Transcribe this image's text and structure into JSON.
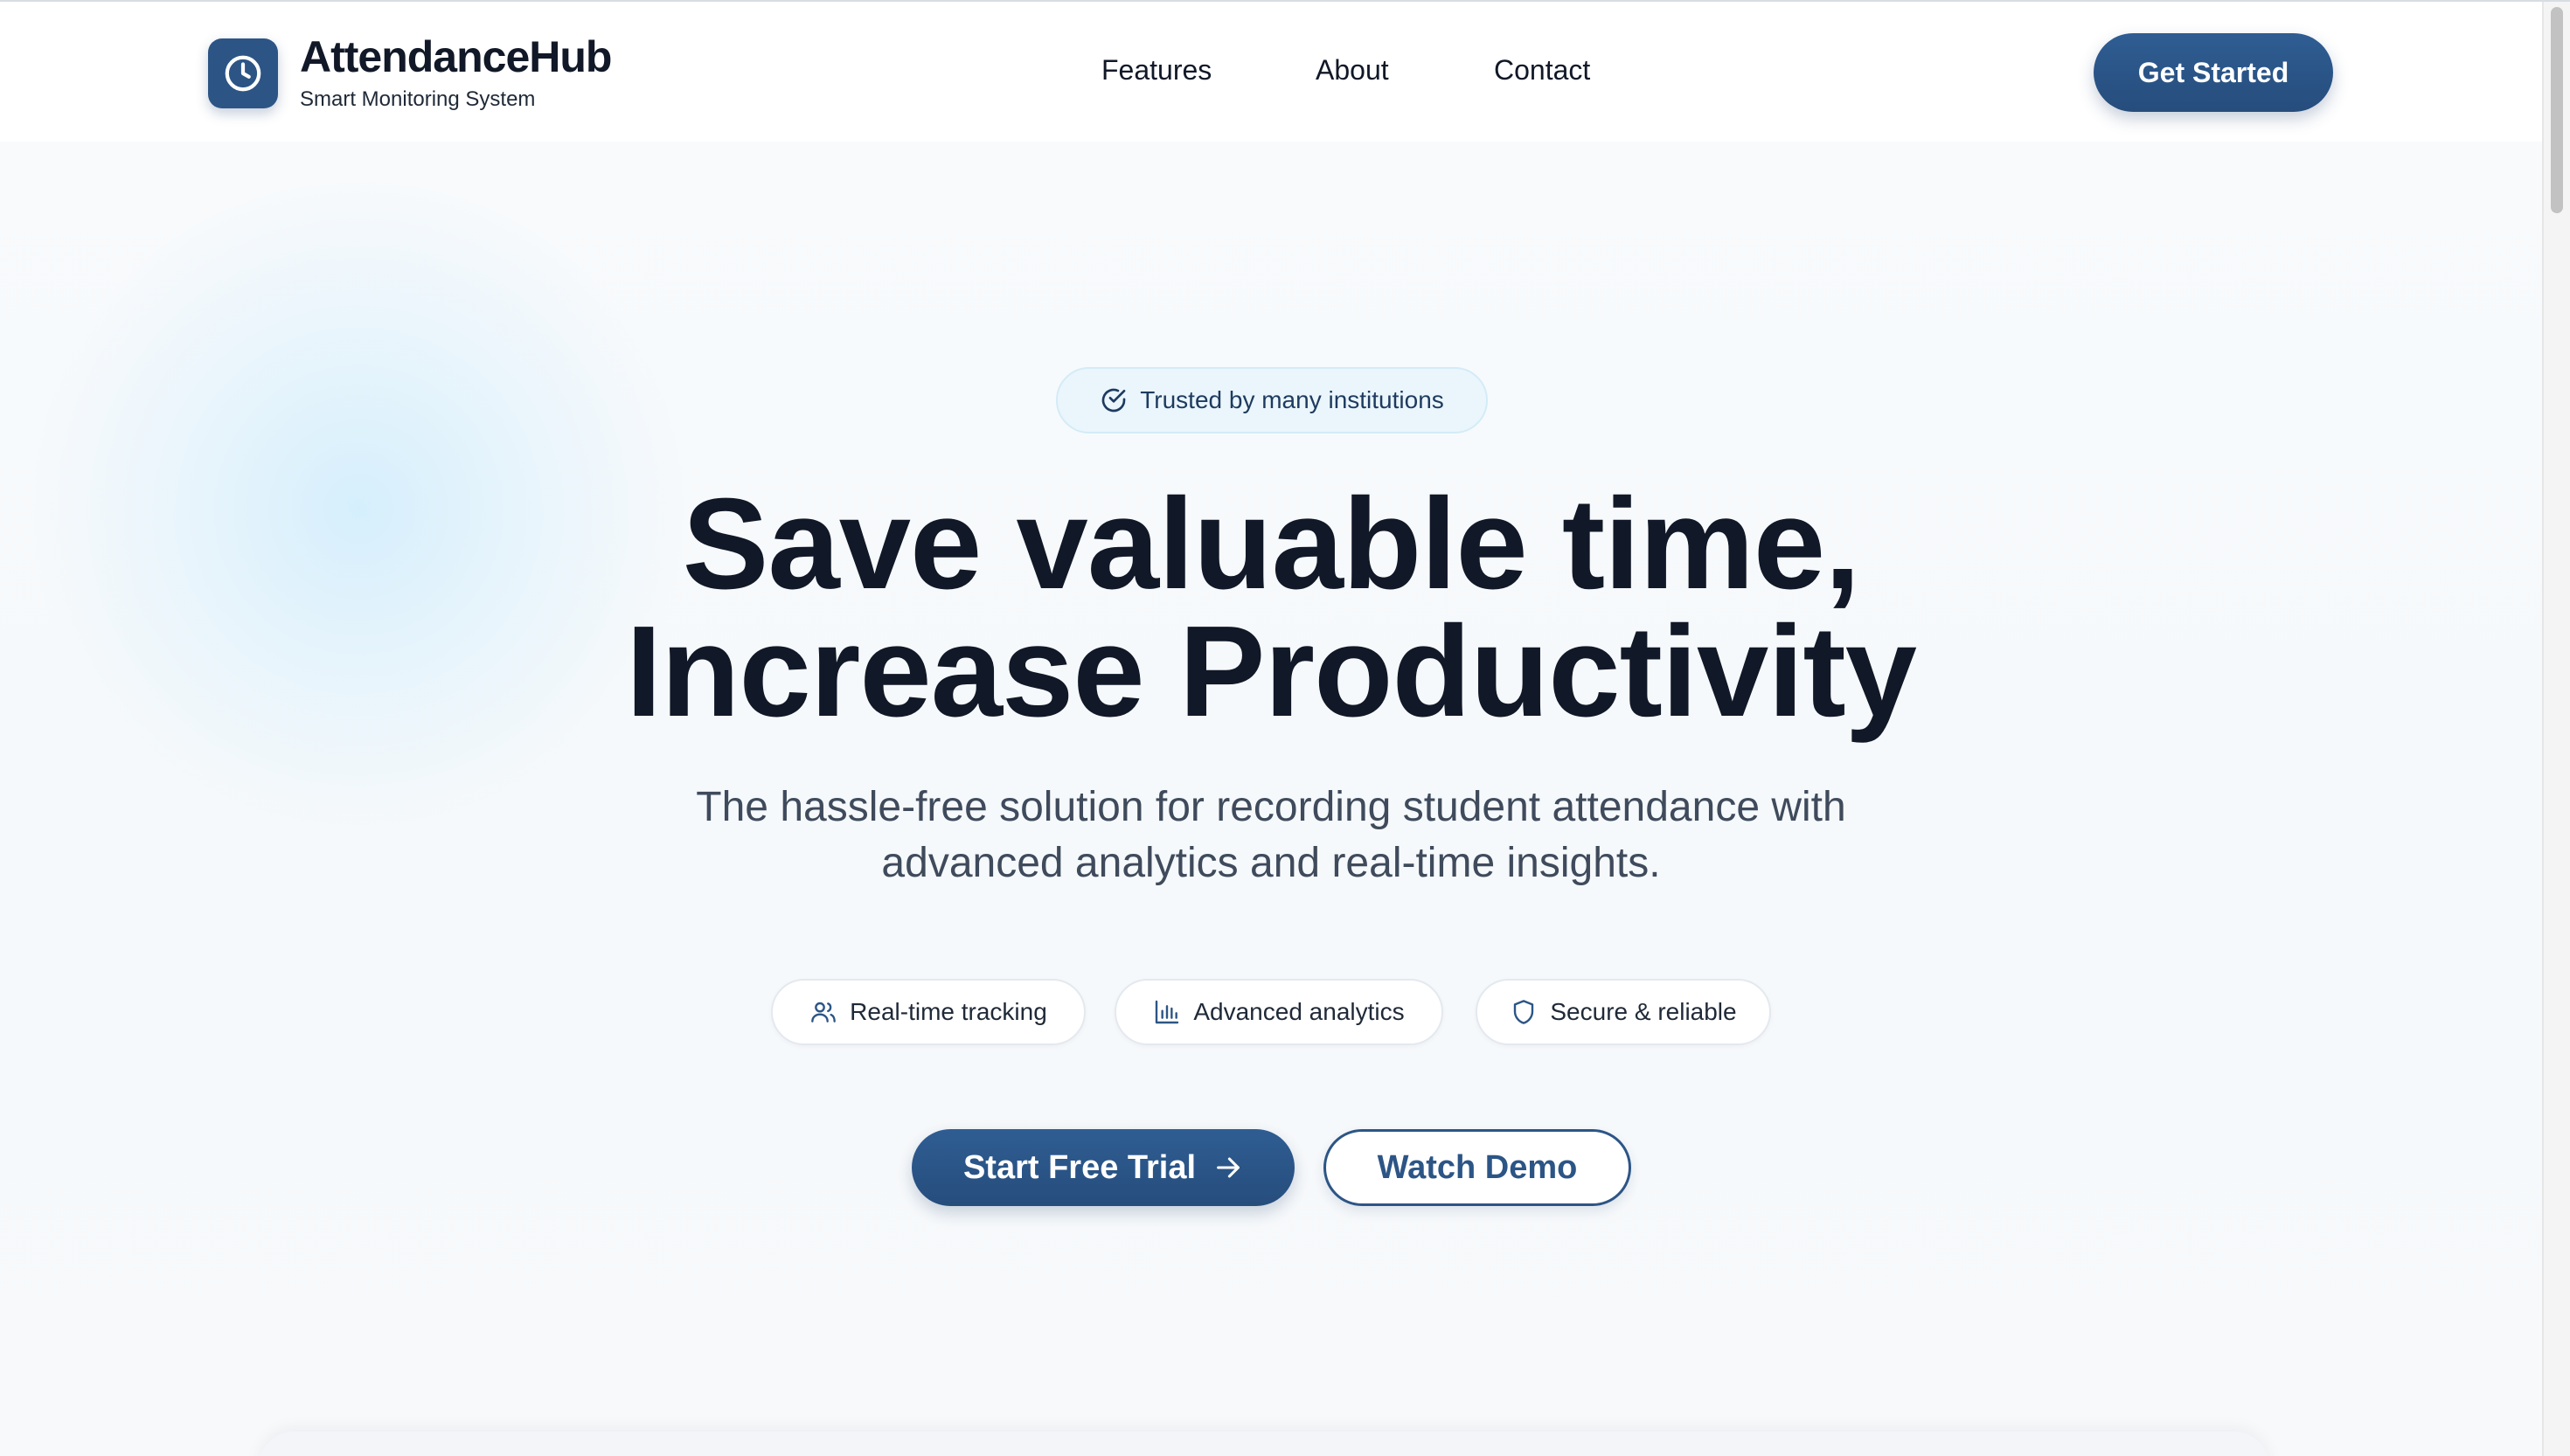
{
  "colors": {
    "primary": "#2c5586",
    "heading": "#111827",
    "subtext": "#3f4b5c",
    "badge_bg": "#eaf6fc"
  },
  "header": {
    "logo_icon": "clock-icon",
    "brand_name": "AttendanceHub",
    "brand_tagline": "Smart Monitoring System",
    "nav": [
      {
        "label": "Features"
      },
      {
        "label": "About"
      },
      {
        "label": "Contact"
      }
    ],
    "cta_label": "Get Started"
  },
  "hero": {
    "badge": {
      "icon": "check-circle-icon",
      "text": "Trusted by many institutions"
    },
    "title_line1": "Save valuable time,",
    "title_line2": "Increase Productivity",
    "subtitle_line1": "The hassle-free solution for recording student attendance with",
    "subtitle_line2": "advanced analytics and real-time insights.",
    "features": [
      {
        "icon": "users-icon",
        "label": "Real-time tracking"
      },
      {
        "icon": "bar-chart-icon",
        "label": "Advanced analytics"
      },
      {
        "icon": "shield-icon",
        "label": "Secure & reliable"
      }
    ],
    "primary_cta": {
      "label": "Start Free Trial",
      "icon": "arrow-right-icon"
    },
    "secondary_cta": {
      "label": "Watch Demo"
    }
  }
}
